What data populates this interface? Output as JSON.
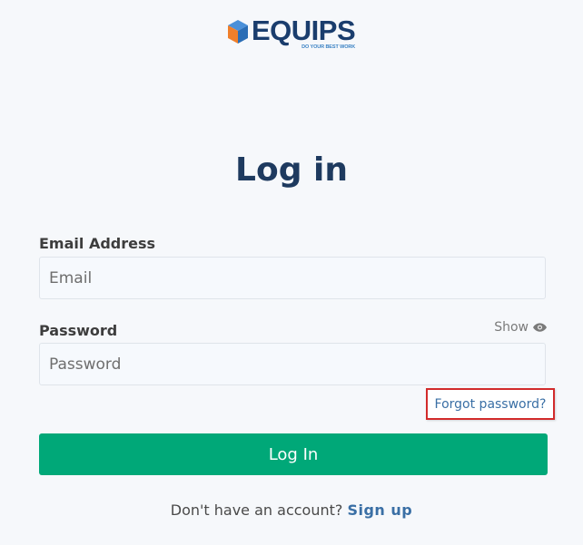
{
  "logo": {
    "word": "EQUIPS",
    "tagline": "DO YOUR BEST WORK",
    "icon": "cube-logo-icon",
    "colors": {
      "cube_left": "#f07f2a",
      "cube_right": "#2a6db5",
      "cube_top": "#4a90d9",
      "word": "#1a3d6d",
      "tagline": "#3b82c4"
    }
  },
  "heading": "Log in",
  "email": {
    "label": "Email Address",
    "placeholder": "Email",
    "value": ""
  },
  "password": {
    "label": "Password",
    "placeholder": "Password",
    "value": "",
    "show_label": "Show",
    "show_icon": "eye-icon"
  },
  "forgot_password": "Forgot password?",
  "login_button": "Log In",
  "signup": {
    "prompt": "Don't have an account?",
    "link": "Sign up"
  },
  "colors": {
    "background": "#f6f8fb",
    "heading": "#1e3a5f",
    "primary_button": "#00a878",
    "link": "#3a6fa5",
    "highlight_border": "#d22b2b"
  }
}
